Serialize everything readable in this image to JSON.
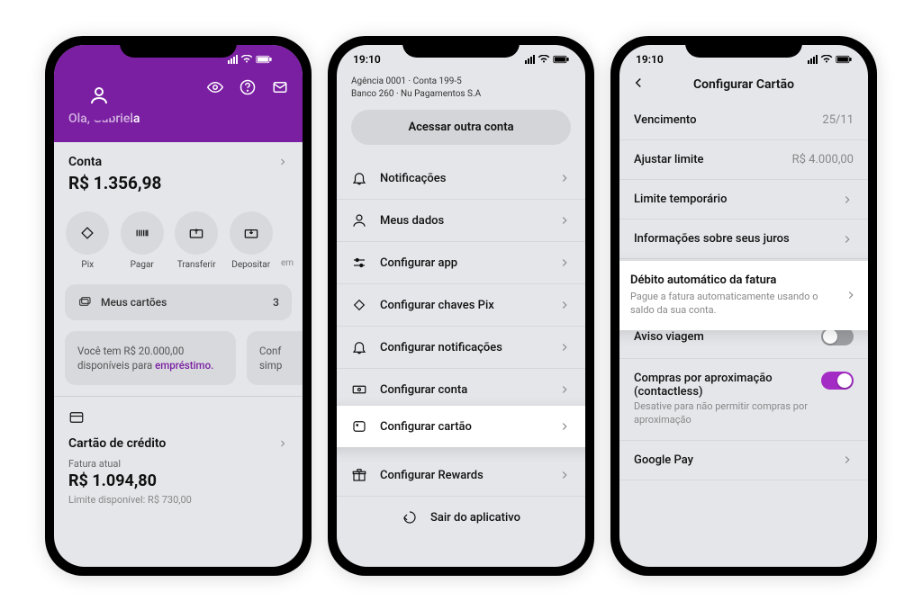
{
  "status": {
    "time": "19:10"
  },
  "phone1": {
    "greeting": "Olá, Gabriela",
    "account_label": "Conta",
    "balance": "R$ 1.356,98",
    "actions": [
      {
        "label": "Pix"
      },
      {
        "label": "Pagar"
      },
      {
        "label": "Transferir"
      },
      {
        "label": "Depositar"
      }
    ],
    "cards_label": "Meus cartões",
    "cards_count": "3",
    "info1_prefix": "Você tem R$ 20.000,00 disponíveis para ",
    "info1_highlight": "empréstimo.",
    "info2_prefix": "Conf",
    "info2_line2": "simp",
    "cc_title": "Cartão de crédito",
    "cc_sub": "Fatura atual",
    "cc_amount": "R$ 1.094,80",
    "cc_limit": "Limite disponível: R$ 730,00"
  },
  "phone2": {
    "bank_line1": "Agência 0001 · Conta 199-5",
    "bank_line2": "Banco 260 · Nu Pagamentos S.A",
    "access_btn": "Acessar outra conta",
    "items": [
      {
        "label": "Notificações"
      },
      {
        "label": "Meus dados"
      },
      {
        "label": "Configurar app"
      },
      {
        "label": "Configurar chaves Pix"
      },
      {
        "label": "Configurar notificações"
      },
      {
        "label": "Configurar conta"
      },
      {
        "label": "Configurar cartão"
      },
      {
        "label": "Configurar Rewards"
      }
    ],
    "exit": "Sair do aplicativo"
  },
  "phone3": {
    "title": "Configurar Cartão",
    "rows": {
      "vencimento_label": "Vencimento",
      "vencimento_val": "25/11",
      "limite_label": "Ajustar limite",
      "limite_val": "R$ 4.000,00",
      "lim_temp": "Limite temporário",
      "juros": "Informações sobre seus juros",
      "debito_title": "Débito automático da fatura",
      "debito_sub": "Pague a fatura automaticamente usando o saldo da sua conta.",
      "aviso": "Aviso viagem",
      "contactless_title": "Compras por aproximação (contactless)",
      "contactless_sub": "Desative para não permitir compras por aproximação",
      "gpay": "Google Pay"
    }
  }
}
